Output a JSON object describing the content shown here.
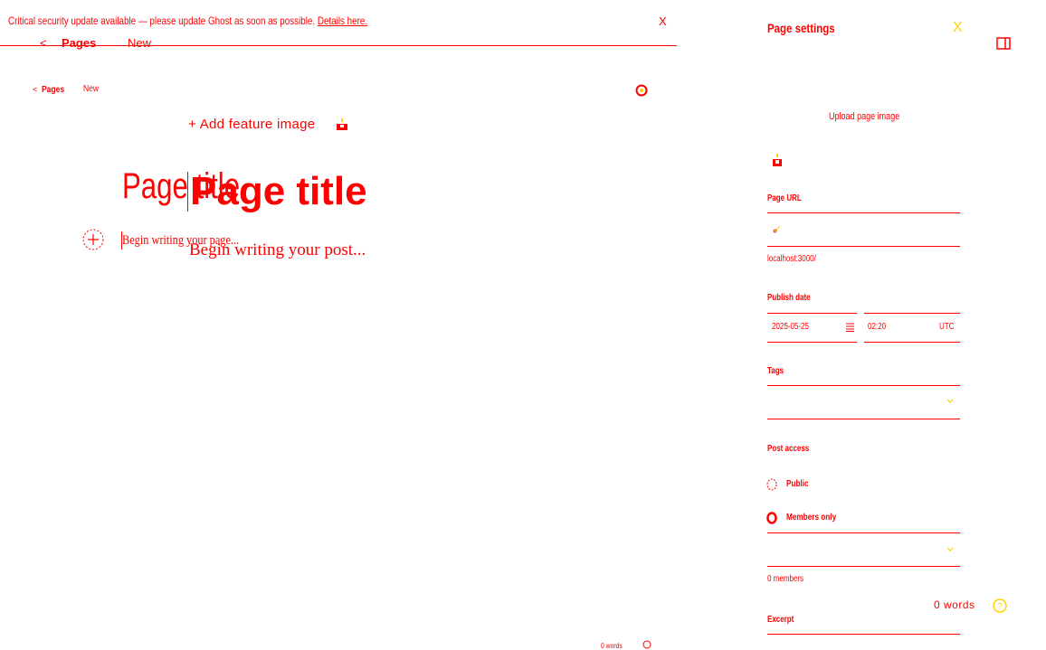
{
  "banner": {
    "message": "Critical security update available — please update Ghost as soon as possible.",
    "link": "Details here.",
    "close": "X"
  },
  "topnav": {
    "back": "<",
    "pages": "Pages",
    "status": "New"
  },
  "subnav": {
    "back": "<",
    "pages": "Pages",
    "status": "New"
  },
  "editor": {
    "feature_image": "+ Add feature image",
    "title_placeholder": "Page title",
    "title_overlay": "Page title",
    "body_placeholder": "Begin writing your page...",
    "body_overlay": "Begin writing your post...",
    "word_count": "0 words",
    "word_count_small": "0 words"
  },
  "settings": {
    "title": "Page settings",
    "close": "X",
    "upload": "Upload page image",
    "url_label": "Page URL",
    "url_value": "localhost:3000/",
    "publish_label": "Publish date",
    "date": "2025-05-25",
    "time": "02:20",
    "tz": "UTC",
    "tags_label": "Tags",
    "access_label": "Post access",
    "access_options": [
      "Public",
      "Members only"
    ],
    "members_count": "0 members",
    "excerpt_label": "Excerpt"
  },
  "colors": {
    "primary": "#ff0000",
    "accent": "#ffd400",
    "background": "#ffffff"
  }
}
